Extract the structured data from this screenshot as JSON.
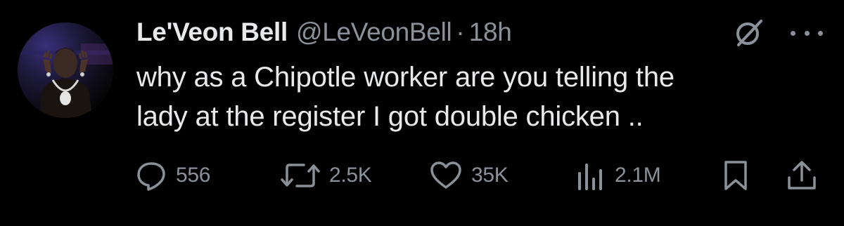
{
  "tweet": {
    "author": {
      "display_name": "Le'Veon Bell",
      "handle": "@LeVeonBell"
    },
    "separator": "·",
    "timestamp": "18h",
    "text_line1": "why as a Chipotle worker are you telling the",
    "text_line2": "lady at the register I got double chicken ..",
    "actions": {
      "replies": "556",
      "reposts": "2.5K",
      "likes": "35K",
      "views": "2.1M"
    },
    "icons": {
      "avatar": "avatar",
      "grok": "grok-icon",
      "more": "more-icon",
      "reply": "reply-icon",
      "repost": "repost-icon",
      "like": "heart-icon",
      "views": "bar-chart-icon",
      "bookmark": "bookmark-icon",
      "share": "share-icon"
    },
    "colors": {
      "background": "#000000",
      "primary_text": "#e7e9ea",
      "secondary_text": "#8b9198"
    }
  }
}
